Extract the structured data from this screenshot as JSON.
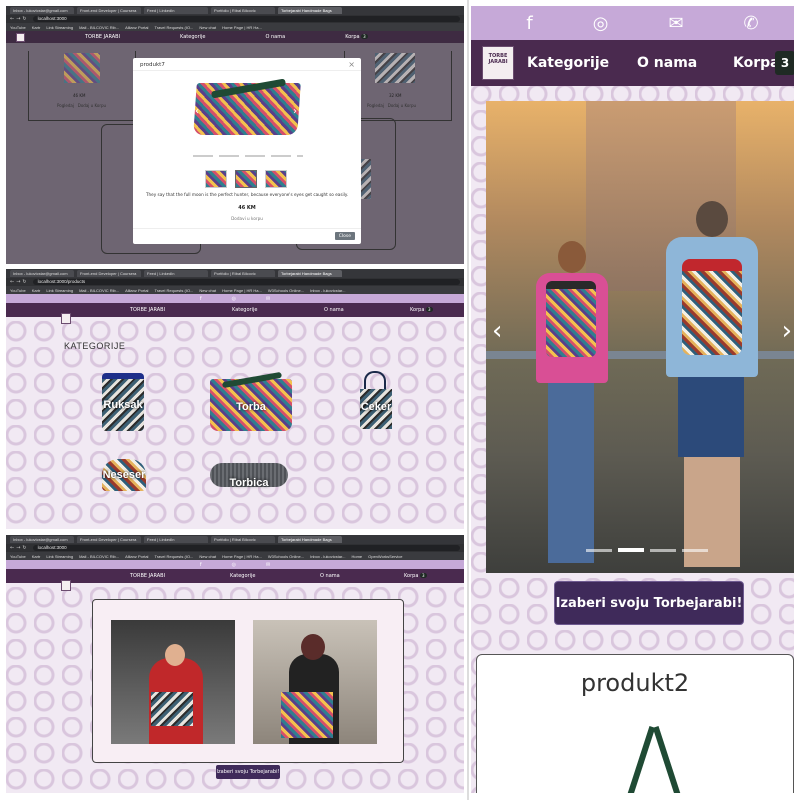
{
  "browser": {
    "tabs_top": [
      "Inbox - lukovicstar@gmail.com",
      "Front-end Developer | Coursera",
      "Feed | LinkedIn",
      "Portfolio | Ribal Bilcovic",
      "Torbejarabi Handmade Bags"
    ],
    "tabs_mid": [
      "Inbox - lukovicstar@gmail.com",
      "Front-end Developer | Coursera",
      "Feed | LinkedIn",
      "Portfolio | Ribal Bilcovic",
      "Torbejarabi Handmade Bags"
    ],
    "tabs_bot": [
      "Inbox - lukovicstar@gmail.com",
      "Front-end Developer | Coursera",
      "Feed | LinkedIn",
      "Portfolio | Ribal Bilcovic",
      "Torbejarabi Handmade Bags"
    ],
    "url_top": "localhost:3000",
    "url_mid": "localhost:3000/products",
    "url_bot": "localhost:3000",
    "bookmarks": [
      "YouTube",
      "Kartr",
      "Link Streaming",
      "Mail - BILCOVIC Rib...",
      "Allianz Portal",
      "Travel Requests (IO...",
      "New chat",
      "Home Page | HR Ha...",
      "W3Schools Online...",
      "Inbox - lukovicstar...",
      "Home",
      "OpenWorksService"
    ]
  },
  "site": {
    "brand": "TORBE JARABI",
    "nav_categories": "Kategorije",
    "nav_about": "O nama",
    "nav_cart": "Korpa",
    "cart_count": "3"
  },
  "modal": {
    "title": "produkt7",
    "close_x": "×",
    "description": "They say that the full moon is the perfect hunter, because everyone's eyes get caught so easily.",
    "price": "46 KM",
    "add_to_cart": "Dodavi u korpu",
    "close_button": "Close",
    "bg_price_left": "46 KM",
    "bg_price_right": "32 KM",
    "bg_link_left_a": "Pogledaj",
    "bg_link_left_b": "Dodaj u Korpu",
    "bg_link_right_a": "Pogledaj",
    "bg_link_right_b": "Dodaj u Korpu"
  },
  "categories": {
    "heading": "KATEGORIJE",
    "items": [
      "Ruksak",
      "Torba",
      "Ceker",
      "Neseser",
      "Torbica"
    ]
  },
  "hero": {
    "cta": "Izaberi svoju Torbejarabi!"
  },
  "mobile": {
    "nav_categories": "Kategorije",
    "nav_about": "O nama",
    "nav_cart": "Korpa",
    "cart_count": "3",
    "cta": "Izaberi svoju Torbejarabi!",
    "product_title": "produkt2",
    "logo_text": "TORBE JARABI"
  },
  "colors": {
    "accent": "#4a2a4f",
    "social": "#c6a9d8",
    "button": "#3f2a5a"
  }
}
